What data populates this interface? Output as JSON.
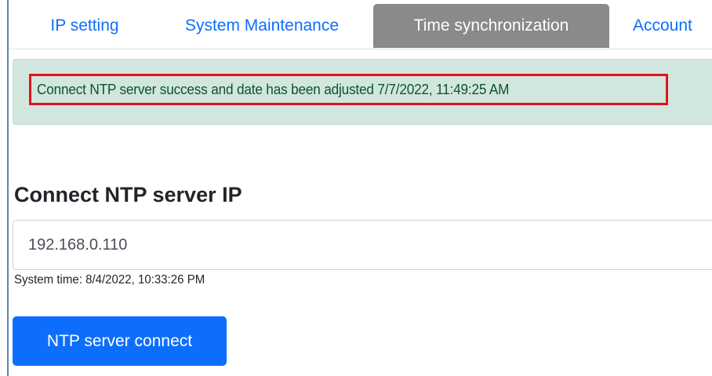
{
  "tabs": [
    {
      "label": "IP setting",
      "active": false
    },
    {
      "label": "System Maintenance",
      "active": false
    },
    {
      "label": "Time synchronization",
      "active": true
    },
    {
      "label": "Account",
      "active": false
    }
  ],
  "alert": {
    "message": "Connect NTP server success and date has been adjusted 7/7/2022, 11:49:25 AM"
  },
  "form": {
    "title": "Connect NTP server IP",
    "ip_value": "192.168.0.110",
    "system_time": "System time: 8/4/2022, 10:33:26 PM",
    "connect_button": "NTP server connect"
  },
  "colors": {
    "accent": "#0d6efd",
    "active_tab": "#8a8a8a",
    "alert_bg": "#d1e7dd",
    "alert_text": "#0f5132",
    "highlight": "#e0141e"
  }
}
